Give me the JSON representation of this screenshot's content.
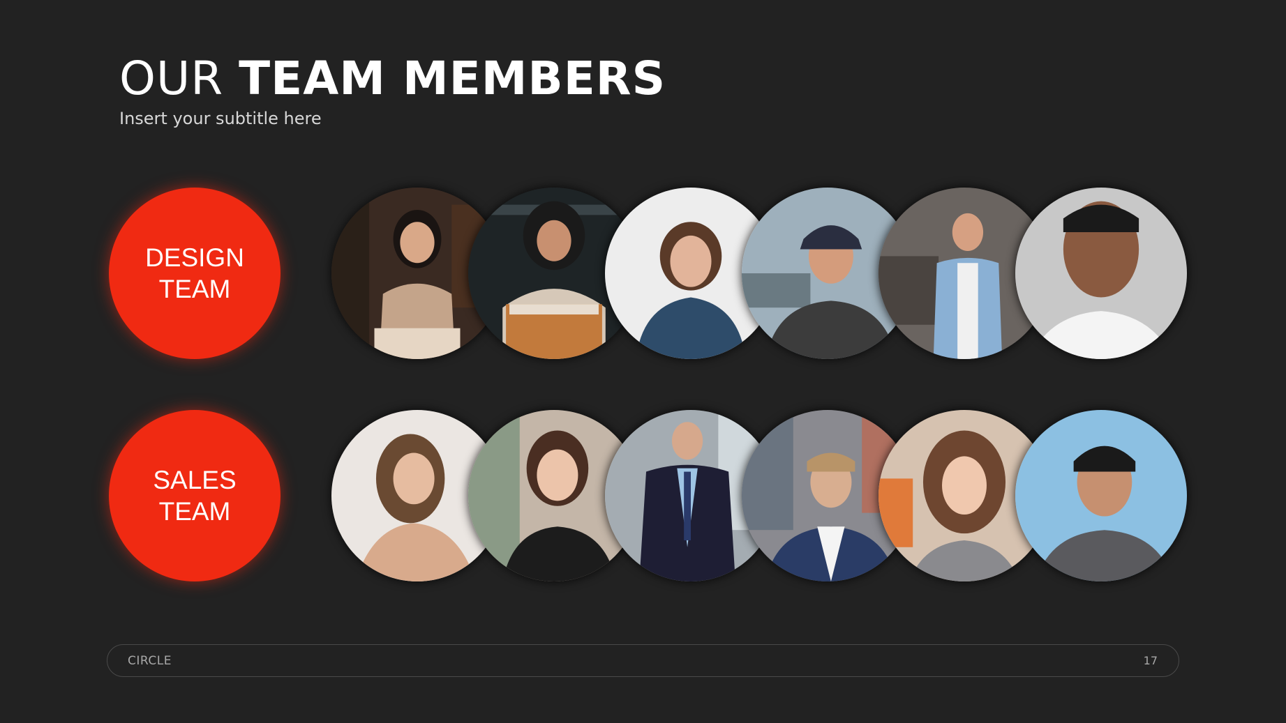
{
  "slide": {
    "title_part1": "OUR",
    "title_part2": "TEAM MEMBERS",
    "subtitle": "Insert your subtitle here"
  },
  "teams": [
    {
      "label_line1": "DESIGN",
      "label_line2": "TEAM",
      "members": [
        {
          "photo": "woman-dark-hair-portrait-photo"
        },
        {
          "photo": "woman-hijab-portrait-photo"
        },
        {
          "photo": "woman-smiling-navy-shirt-photo"
        },
        {
          "photo": "man-cap-smiling-photo"
        },
        {
          "photo": "man-denim-shirt-office-photo"
        },
        {
          "photo": "man-smiling-closeup-photo"
        }
      ]
    },
    {
      "label_line1": "SALES",
      "label_line2": "TEAM",
      "members": [
        {
          "photo": "woman-hand-on-face-photo"
        },
        {
          "photo": "woman-black-top-photo"
        },
        {
          "photo": "man-navy-suit-photo"
        },
        {
          "photo": "man-blue-blazer-city-photo"
        },
        {
          "photo": "woman-curly-hair-photo"
        },
        {
          "photo": "man-backwards-cap-photo"
        }
      ]
    }
  ],
  "footer": {
    "brand": "CIRCLE",
    "page_number": "17"
  },
  "colors": {
    "background": "#222222",
    "accent": "#f02a12",
    "text": "#ffffff"
  }
}
